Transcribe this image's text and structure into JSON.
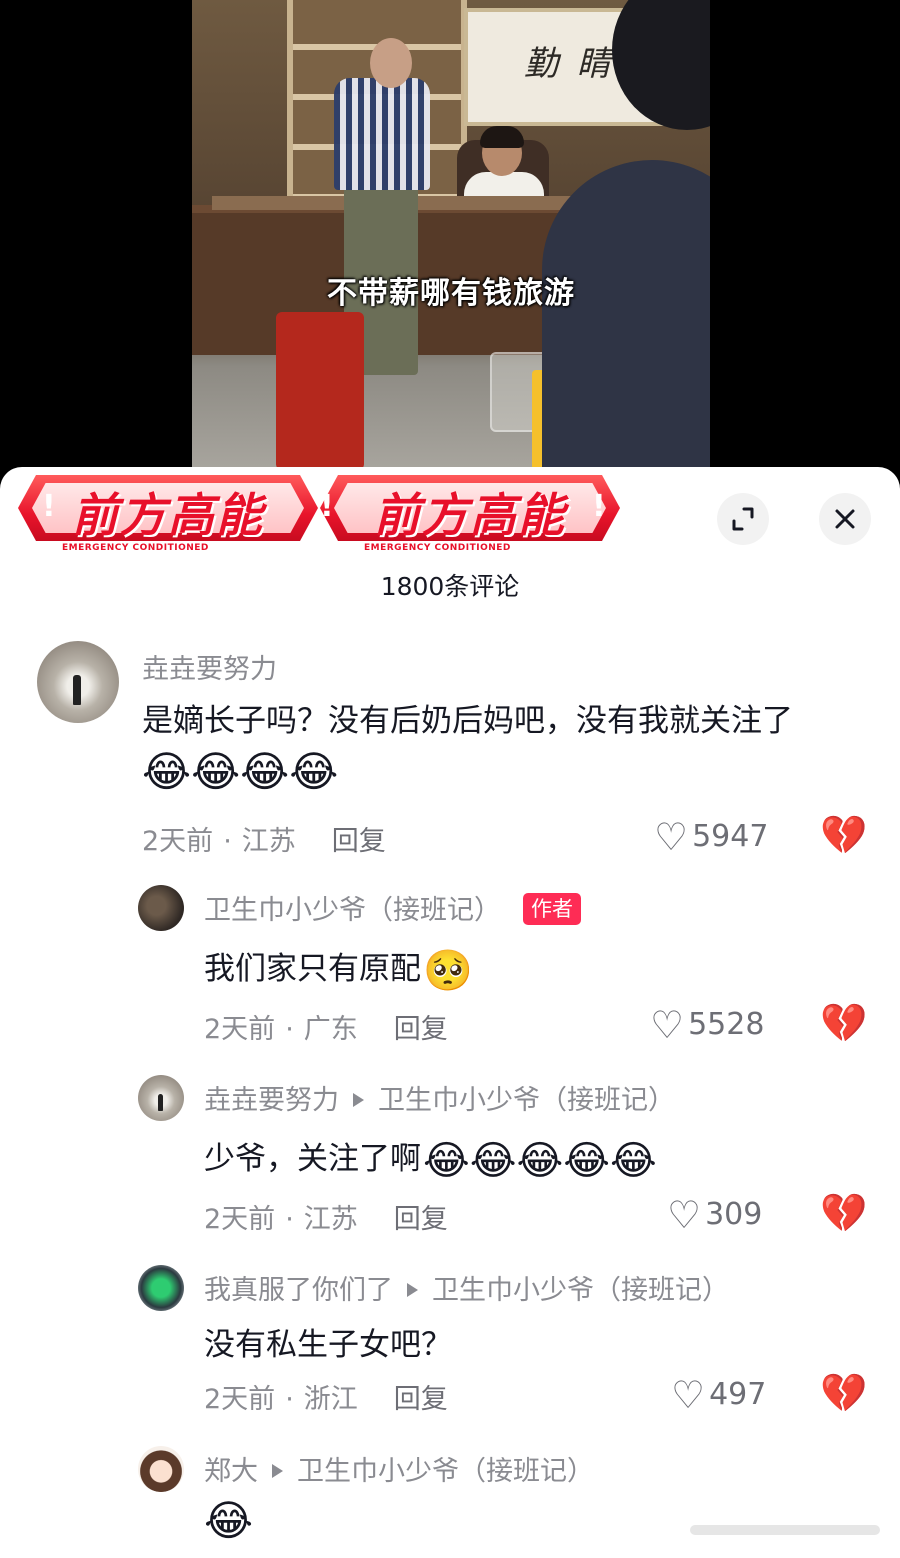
{
  "video": {
    "subtitle": "不带薪哪有钱旅游",
    "calligraphy": "勤 睛 道"
  },
  "sheet": {
    "banner_text": "前方高能",
    "banner_sub": "EMERGENCY CONDITIONED",
    "banner_bang": "!",
    "expand_icon": "expand-icon",
    "close_icon": "close-icon",
    "comment_count": "1800条评论"
  },
  "comments": [
    {
      "username": "垚垚要努力",
      "text": "是嫡长子吗？没有后奶后妈吧，没有我就关注了",
      "emoji": "😂😂😂😂",
      "time": "2天前",
      "location": "江苏",
      "reply": "回复",
      "likes": "5947"
    },
    {
      "username": "卫生巾小少爷（接班记）",
      "badge": "作者",
      "text": "我们家只有原配",
      "emoji": "🥺",
      "time": "2天前",
      "location": "广东",
      "reply": "回复",
      "likes": "5528"
    },
    {
      "username": "垚垚要努力",
      "reply_to": "卫生巾小少爷（接班记）",
      "text": "少爷，关注了啊",
      "emoji": "😂😂😂😂😂",
      "time": "2天前",
      "location": "江苏",
      "reply": "回复",
      "likes": "309"
    },
    {
      "username": "我真服了你们了",
      "reply_to": "卫生巾小少爷（接班记）",
      "text": "没有私生子女吧？",
      "time": "2天前",
      "location": "浙江",
      "reply": "回复",
      "likes": "497"
    },
    {
      "username": "郑大",
      "reply_to": "卫生巾小少爷（接班记）",
      "emoji": "😂"
    }
  ],
  "icons": {
    "like": "heart-outline-icon",
    "dislike": "broken-heart-icon"
  }
}
